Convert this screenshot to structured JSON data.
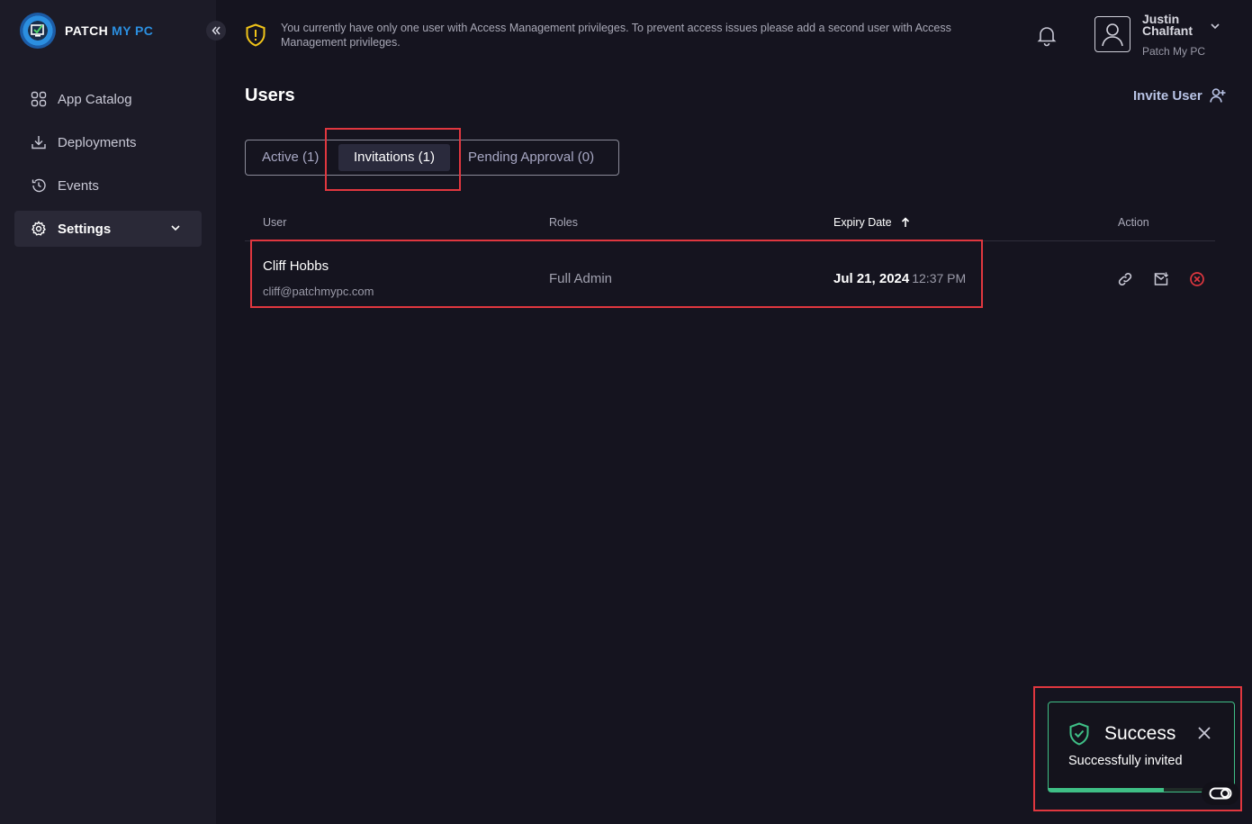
{
  "brand": {
    "name_part1": "PATCH",
    "name_part2": "MY PC"
  },
  "sidebar": {
    "items": [
      {
        "label": "App Catalog",
        "icon": "grid-icon"
      },
      {
        "label": "Deployments",
        "icon": "download-icon"
      },
      {
        "label": "Events",
        "icon": "history-icon"
      },
      {
        "label": "Settings",
        "icon": "gear-icon",
        "active": true
      }
    ]
  },
  "banner": {
    "text": "You currently have only one user with Access Management privileges. To prevent access issues please add a second user with Access Management privileges."
  },
  "user": {
    "first_name": "Justin",
    "last_name": "Chalfant",
    "org": "Patch My PC"
  },
  "page": {
    "title": "Users",
    "invite_label": "Invite User",
    "tabs": [
      {
        "label": "Active (1)"
      },
      {
        "label": "Invitations (1)",
        "selected": true
      },
      {
        "label": "Pending Approval (0)"
      }
    ]
  },
  "table": {
    "headers": {
      "user": "User",
      "roles": "Roles",
      "expiry": "Expiry Date",
      "action": "Action"
    },
    "rows": [
      {
        "name": "Cliff Hobbs",
        "email": "cliff@patchmypc.com",
        "role": "Full Admin",
        "date": "Jul 21, 2024",
        "time": "12:37 PM"
      }
    ]
  },
  "toast": {
    "title": "Success",
    "message": "Successfully invited",
    "progress": 0.62
  },
  "colors": {
    "accent_blue": "#2b8fe0",
    "success_green": "#3fbf86",
    "danger_red": "#e0373f",
    "warning_yellow": "#f0c419"
  }
}
